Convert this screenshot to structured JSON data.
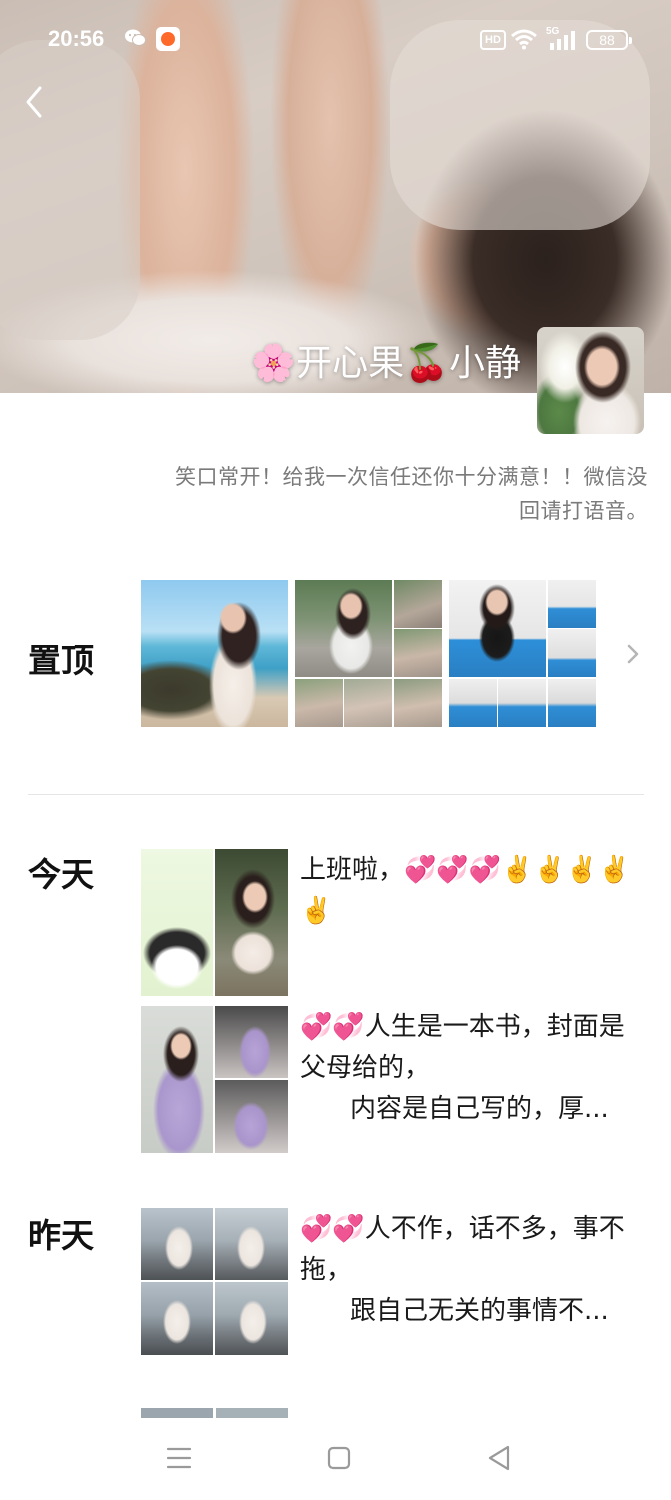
{
  "status_bar": {
    "time": "20:56",
    "hd_label": "HD",
    "network_label": "5G",
    "battery": "88",
    "icons": [
      "wechat-icon",
      "app-notification-icon",
      "wifi-icon",
      "signal-icon",
      "battery-icon"
    ]
  },
  "header": {
    "back_icon": "chevron-left-icon",
    "name": "🌸开心果🍒小静",
    "signature": "笑口常开！给我一次信任还你十分满意！！微信没回请打语音。"
  },
  "pinned": {
    "label": "置顶",
    "more_icon": "chevron-right-icon"
  },
  "feed": [
    {
      "label": "今天",
      "posts": [
        {
          "text": "上班啦，💞💞💞✌️✌️✌️✌️✌️",
          "text_continuation": ""
        },
        {
          "text": "💞💞人生是一本书，封面是父母给的，",
          "text_continuation": "内容是自己写的，厚..."
        }
      ]
    },
    {
      "label": "昨天",
      "posts": [
        {
          "text": "💞💞人不作，话不多，事不拖，",
          "text_continuation": "跟自己无关的事情不..."
        }
      ]
    }
  ],
  "nav_bar": {
    "icons": [
      "menu-icon",
      "home-square-icon",
      "back-triangle-icon"
    ]
  },
  "colors": {
    "page_background": "#ffffff",
    "signature_text": "#7a7a7a",
    "divider": "#e5e5e5",
    "nav_icons": "#9a9a9a"
  }
}
